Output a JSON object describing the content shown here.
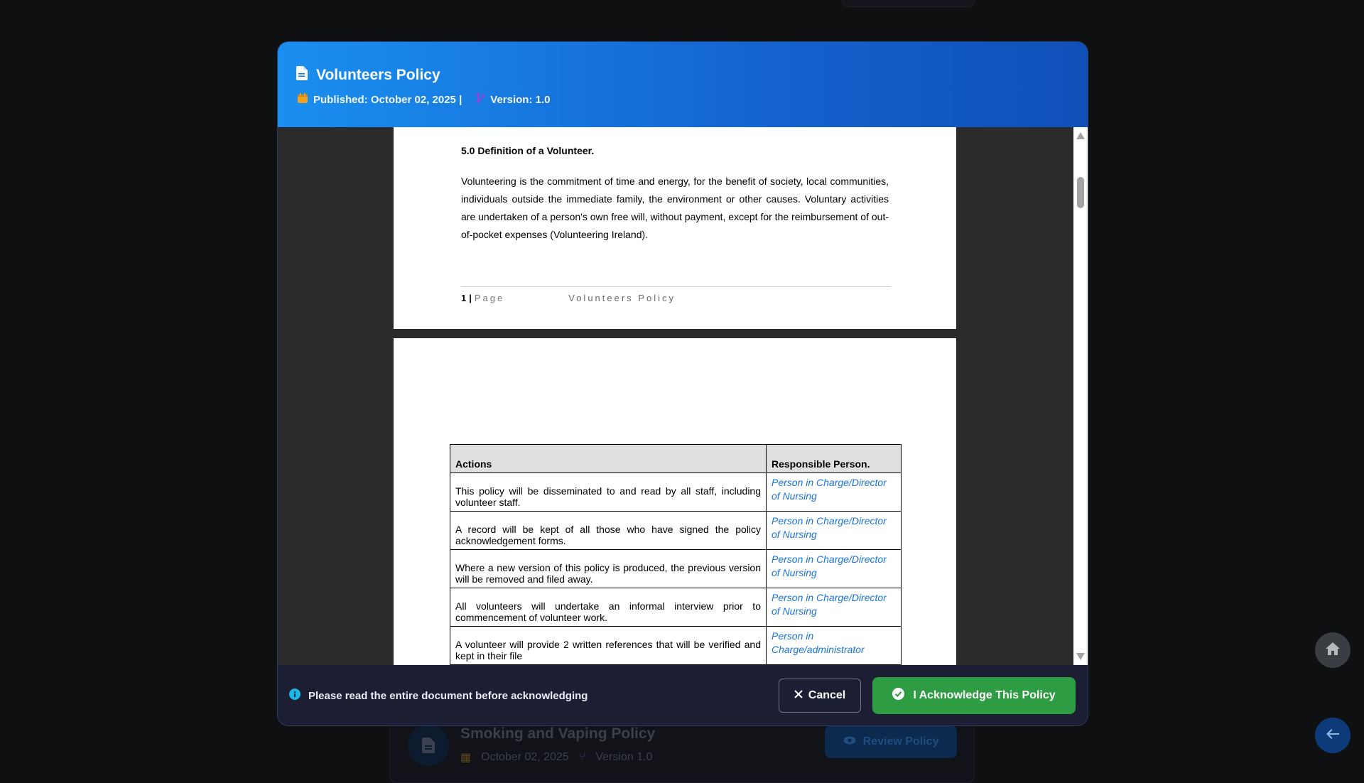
{
  "background": {
    "card_title": "Smoking and Vaping Policy",
    "card_date": "October 02, 2025",
    "card_version": "Version 1.0",
    "review_label": "Review Policy"
  },
  "modal": {
    "title": "Volunteers Policy",
    "published": "Published: October 02, 2025 |",
    "version": "Version: 1.0"
  },
  "document": {
    "page1": {
      "heading": "5.0  Definition of a Volunteer.",
      "body": "Volunteering is the commitment of time and energy, for the benefit of society, local communities, individuals outside the immediate family, the environment or other causes. Voluntary activities are undertaken of a person's own free will, without payment, except for the reimbursement of out-of-pocket expenses (Volunteering Ireland).",
      "footer_num": "1",
      "footer_sep": "|",
      "footer_page": "Page",
      "footer_doc": "Volunteers Policy"
    },
    "table": {
      "headers": [
        "Actions",
        "Responsible Person."
      ],
      "rows": [
        {
          "action": "This policy will be disseminated to and read by all staff, including volunteer staff.",
          "responsible": "Person in Charge/Director of Nursing"
        },
        {
          "action": "A record will be kept of all those who have signed the policy acknowledgement forms.",
          "responsible": "Person in Charge/Director of Nursing"
        },
        {
          "action": "Where a new version of this policy is produced, the previous version will be removed and filed away.",
          "responsible": "Person in Charge/Director of Nursing"
        },
        {
          "action": "All volunteers will undertake an informal interview prior to commencement of volunteer work.",
          "responsible": "Person in Charge/Director of Nursing"
        },
        {
          "action": "A volunteer will provide 2 written references that will be verified and kept in their file",
          "responsible": "Person in Charge/administrator"
        }
      ]
    }
  },
  "footer": {
    "note": "Please read the entire document before acknowledging",
    "cancel_label": "Cancel",
    "acknowledge_label": "I Acknowledge This Policy"
  },
  "colors": {
    "header_start": "#1a8ff0",
    "header_end": "#0f4fb8",
    "acknowledge": "#2e9c43",
    "link_blue": "#1a74d9",
    "calendar": "#f0a21c",
    "version_icon": "#8e44d9"
  }
}
